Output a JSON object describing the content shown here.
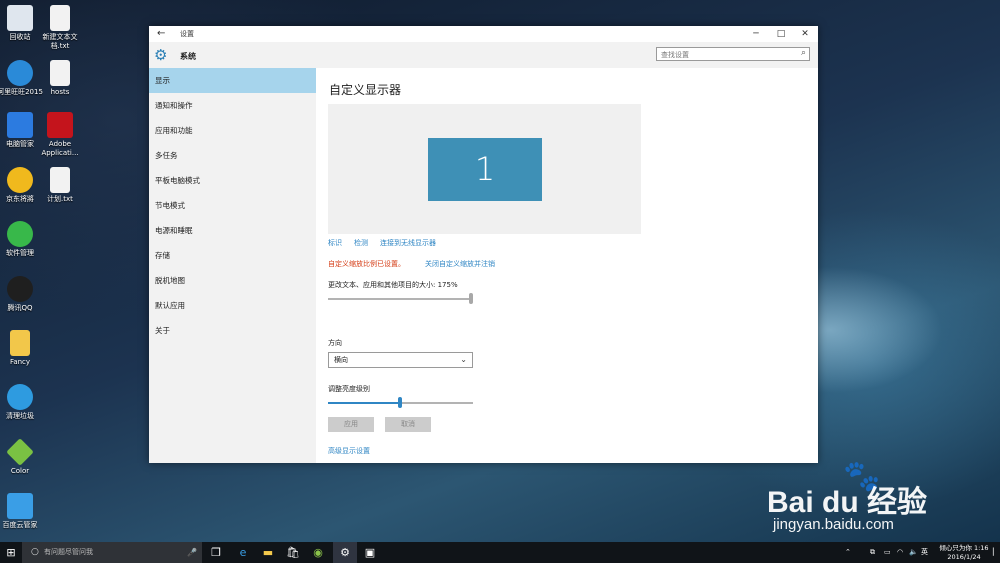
{
  "desktop": {
    "icons": [
      {
        "label": "回收站",
        "color": "#dfe6ee"
      },
      {
        "label": "新建文本文档.txt",
        "color": "#f2f2f2"
      },
      {
        "label": "阿里旺旺2015",
        "color": "#2a8ad8"
      },
      {
        "label": "hosts",
        "color": "#f2f2f2"
      },
      {
        "label": "电脑管家",
        "color": "#2c7be0"
      },
      {
        "label": "Adobe Applicati...",
        "color": "#c4141c"
      },
      {
        "label": "京东将將",
        "color": "#f0b91d"
      },
      {
        "label": "计划.txt",
        "color": "#f2f2f2"
      },
      {
        "label": "软件管理",
        "color": "#38b84a"
      },
      {
        "label": "腾讯QQ",
        "color": "#1f1f1f"
      },
      {
        "label": "Fancy",
        "color": "#f2c74a"
      },
      {
        "label": "清理垃圾",
        "color": "#2e9be0"
      },
      {
        "label": "Color",
        "color": "#7ac143"
      },
      {
        "label": "百度云管家",
        "color": "#3a9ee6"
      }
    ]
  },
  "window": {
    "title": "设置",
    "back_glyph": "←",
    "minimize_glyph": "─",
    "maximize_glyph": "□",
    "close_glyph": "✕",
    "section_title": "系统",
    "search_placeholder": "查找设置"
  },
  "sidebar": {
    "items": [
      {
        "label": "显示",
        "active": true
      },
      {
        "label": "通知和操作"
      },
      {
        "label": "应用和功能"
      },
      {
        "label": "多任务"
      },
      {
        "label": "平板电脑模式"
      },
      {
        "label": "节电模式"
      },
      {
        "label": "电源和睡眠"
      },
      {
        "label": "存储"
      },
      {
        "label": "脱机地图"
      },
      {
        "label": "默认应用"
      },
      {
        "label": "关于"
      }
    ]
  },
  "display": {
    "title": "自定义显示器",
    "monitor_number": "1",
    "links": {
      "identify": "标识",
      "detect": "检测",
      "wireless": "连接到无线显示器"
    },
    "custom_scale_warning": "自定义缩放比例已设置。",
    "turn_off_scale_link": "关闭自定义缩放并注销",
    "scale_label": "更改文本、应用和其他项目的大小: 175%",
    "scale_level": 1.0,
    "orientation_label": "方向",
    "orientation_value": "横向",
    "brightness_label": "调整亮度级别",
    "brightness_level": 0.5,
    "apply_label": "应用",
    "cancel_label": "取消",
    "advanced_link": "高级显示设置"
  },
  "taskbar": {
    "search_placeholder": "有问题尽管问我",
    "ime": "英",
    "clock_line1": "倾心只为你 1:16",
    "clock_line2": "2016/1/24"
  },
  "watermark": {
    "brand": "Bai du 经验",
    "url": "jingyan.baidu.com"
  }
}
